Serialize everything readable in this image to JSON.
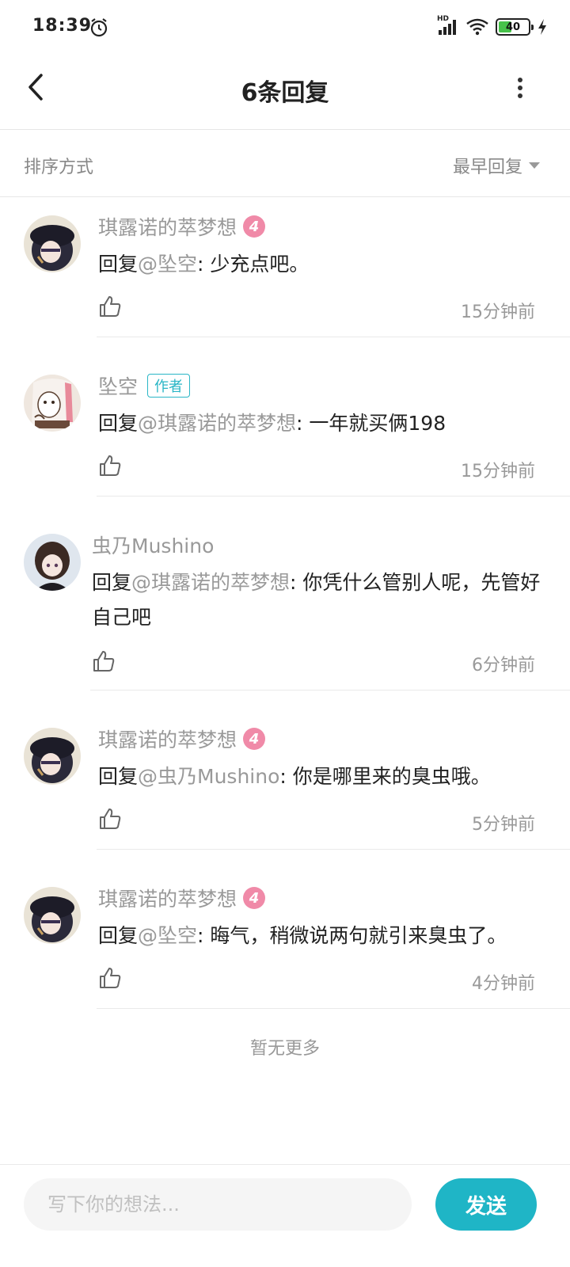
{
  "status_bar": {
    "time": "18:39",
    "battery": "40"
  },
  "header": {
    "title": "6条回复"
  },
  "sort": {
    "label": "排序方式",
    "selected": "最早回复"
  },
  "comments": [
    {
      "name": "琪露诺的萃梦想",
      "level": "4",
      "author_badge": "",
      "prefix": "回复",
      "mention": "@坠空",
      "sep": ": ",
      "text": "少充点吧。",
      "time": "15分钟前"
    },
    {
      "name": "坠空",
      "level": "",
      "author_badge": "作者",
      "prefix": "回复",
      "mention": "@琪露诺的萃梦想",
      "sep": ": ",
      "text": "一年就买俩198",
      "time": "15分钟前"
    },
    {
      "name": "虫乃Mushino",
      "level": "",
      "author_badge": "",
      "prefix": "回复",
      "mention": "@琪露诺的萃梦想",
      "sep": ": ",
      "text": "你凭什么管别人呢，先管好自己吧",
      "time": "6分钟前"
    },
    {
      "name": "琪露诺的萃梦想",
      "level": "4",
      "author_badge": "",
      "prefix": "回复",
      "mention": "@虫乃Mushino",
      "sep": ": ",
      "text": "你是哪里来的臭虫哦。",
      "time": "5分钟前"
    },
    {
      "name": "琪露诺的萃梦想",
      "level": "4",
      "author_badge": "",
      "prefix": "回复",
      "mention": "@坠空",
      "sep": ": ",
      "text": "晦气，稍微说两句就引来臭虫了。",
      "time": "4分钟前"
    }
  ],
  "footer_note": "暂无更多",
  "input": {
    "placeholder": "写下你的想法..."
  },
  "send_label": "发送",
  "colors": {
    "accent": "#1fb5c6",
    "level_badge": "#f08aa8"
  }
}
